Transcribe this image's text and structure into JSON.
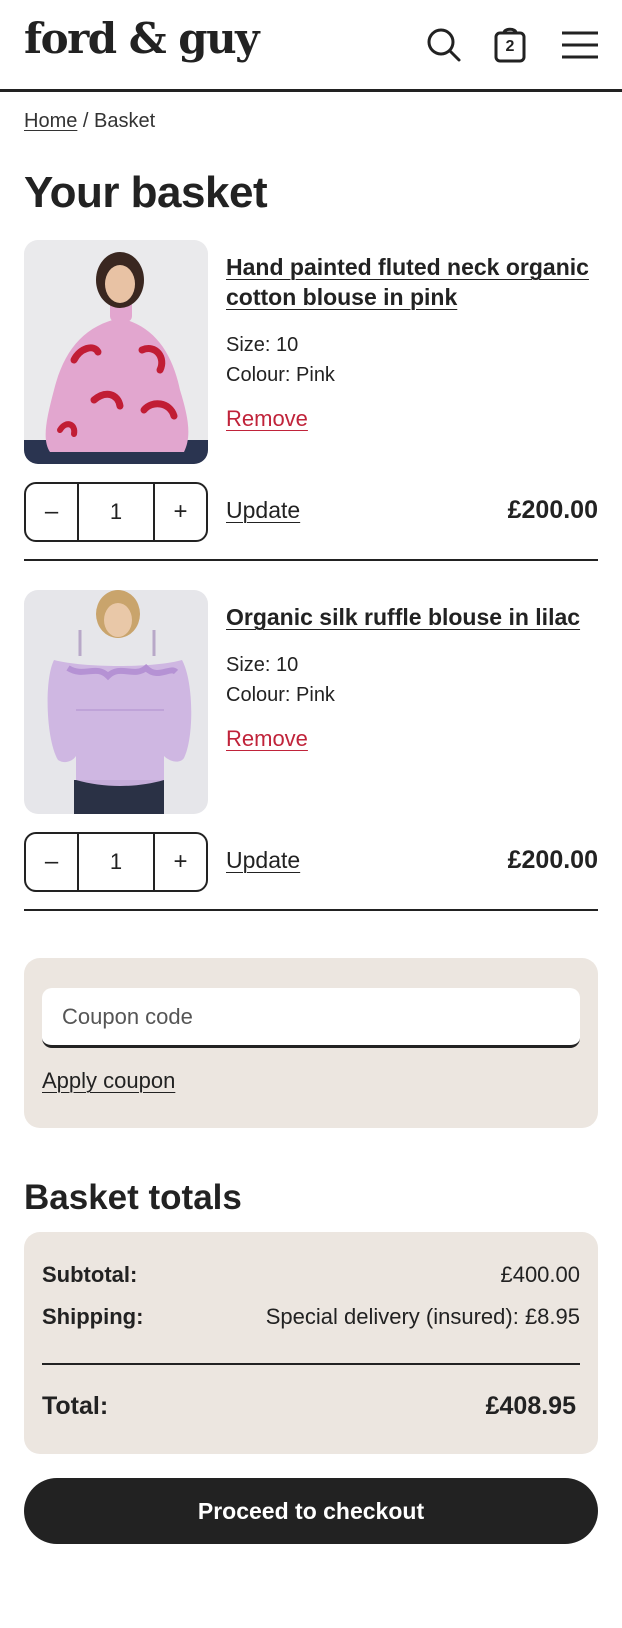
{
  "brand": {
    "logo": "ford & guy"
  },
  "header": {
    "cart_count": "2",
    "icons": [
      "search-icon",
      "bag-icon",
      "menu-icon"
    ]
  },
  "breadcrumb": {
    "home": "Home",
    "separator": " / ",
    "current": "Basket"
  },
  "page_title": "Your basket",
  "items": [
    {
      "name": "Hand painted fluted neck organic cotton blouse in pink",
      "size": "Size: 10",
      "colour": "Colour: Pink",
      "remove_label": "Remove",
      "qty_minus": "–",
      "quantity": "1",
      "qty_plus": "+",
      "update_label": "Update",
      "price": "£200.00"
    },
    {
      "name": "Organic silk ruffle blouse in lilac",
      "size": "Size: 10",
      "colour": "Colour: Pink",
      "remove_label": "Remove",
      "qty_minus": "–",
      "quantity": "1",
      "qty_plus": "+",
      "update_label": "Update",
      "price": "£200.00"
    }
  ],
  "coupon": {
    "placeholder": "Coupon code",
    "apply_label": "Apply coupon"
  },
  "totals": {
    "title": "Basket totals",
    "subtotal_label": "Subtotal:",
    "subtotal_value": "£400.00",
    "shipping_label": "Shipping:",
    "shipping_value": "Special delivery (insured): £8.95",
    "total_label": "Total:",
    "total_value": "£408.95"
  },
  "checkout_label": "Proceed to checkout",
  "colors": {
    "text": "#222222",
    "remove": "#c0233a",
    "panel": "#ece6e0",
    "button": "#222222"
  }
}
